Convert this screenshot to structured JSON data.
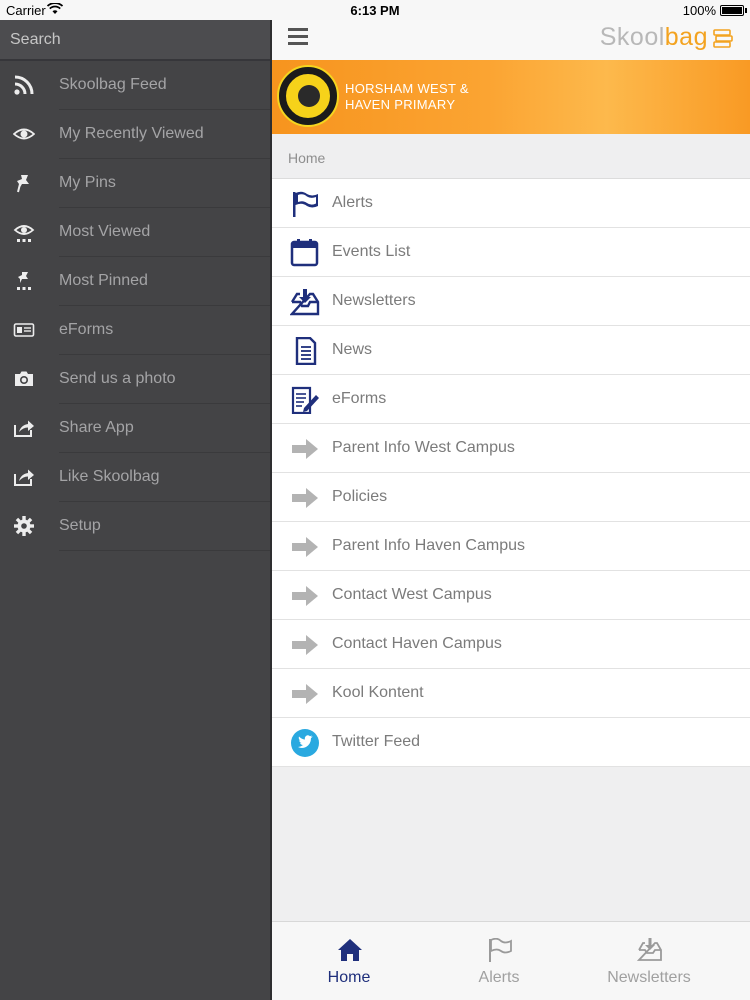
{
  "status_bar": {
    "carrier": "Carrier",
    "time": "6:13 PM",
    "battery": "100%"
  },
  "sidebar": {
    "search_placeholder": "Search",
    "items": [
      {
        "label": "Skoolbag Feed",
        "icon": "rss-icon"
      },
      {
        "label": "My Recently Viewed",
        "icon": "eye-icon"
      },
      {
        "label": "My Pins",
        "icon": "pin-icon"
      },
      {
        "label": "Most Viewed",
        "icon": "eye-ranked-icon"
      },
      {
        "label": "Most Pinned",
        "icon": "pin-ranked-icon"
      },
      {
        "label": "eForms",
        "icon": "id-card-icon"
      },
      {
        "label": "Send us a photo",
        "icon": "camera-icon"
      },
      {
        "label": "Share App",
        "icon": "share-icon"
      },
      {
        "label": "Like Skoolbag",
        "icon": "share-icon"
      },
      {
        "label": "Setup",
        "icon": "gear-icon"
      }
    ]
  },
  "header": {
    "brand_part1": "Skool",
    "brand_part2": "bag",
    "school_line1": "HORSHAM WEST &",
    "school_line2": "HAVEN PRIMARY"
  },
  "breadcrumb": "Home",
  "menu": [
    {
      "label": "Alerts",
      "icon": "flag-icon"
    },
    {
      "label": "Events List",
      "icon": "calendar-icon"
    },
    {
      "label": "Newsletters",
      "icon": "inbox-download-icon"
    },
    {
      "label": "News",
      "icon": "document-icon"
    },
    {
      "label": "eForms",
      "icon": "form-edit-icon"
    },
    {
      "label": "Parent Info West Campus",
      "icon": "arrow-right-icon"
    },
    {
      "label": "Policies",
      "icon": "arrow-right-icon"
    },
    {
      "label": "Parent Info Haven Campus",
      "icon": "arrow-right-icon"
    },
    {
      "label": "Contact West Campus",
      "icon": "arrow-right-icon"
    },
    {
      "label": "Contact Haven Campus",
      "icon": "arrow-right-icon"
    },
    {
      "label": "Kool Kontent",
      "icon": "arrow-right-icon"
    },
    {
      "label": "Twitter Feed",
      "icon": "twitter-icon"
    }
  ],
  "tabs": [
    {
      "label": "Home",
      "icon": "home-icon",
      "active": true
    },
    {
      "label": "Alerts",
      "icon": "flag-icon",
      "active": false
    },
    {
      "label": "Newsletters",
      "icon": "inbox-download-icon",
      "active": false
    }
  ],
  "colors": {
    "accent_navy": "#1f2f7c",
    "banner_orange": "#f7941e",
    "brand_orange": "#f3a320",
    "sidebar_bg": "#444446",
    "twitter_blue": "#2aa9e0"
  }
}
